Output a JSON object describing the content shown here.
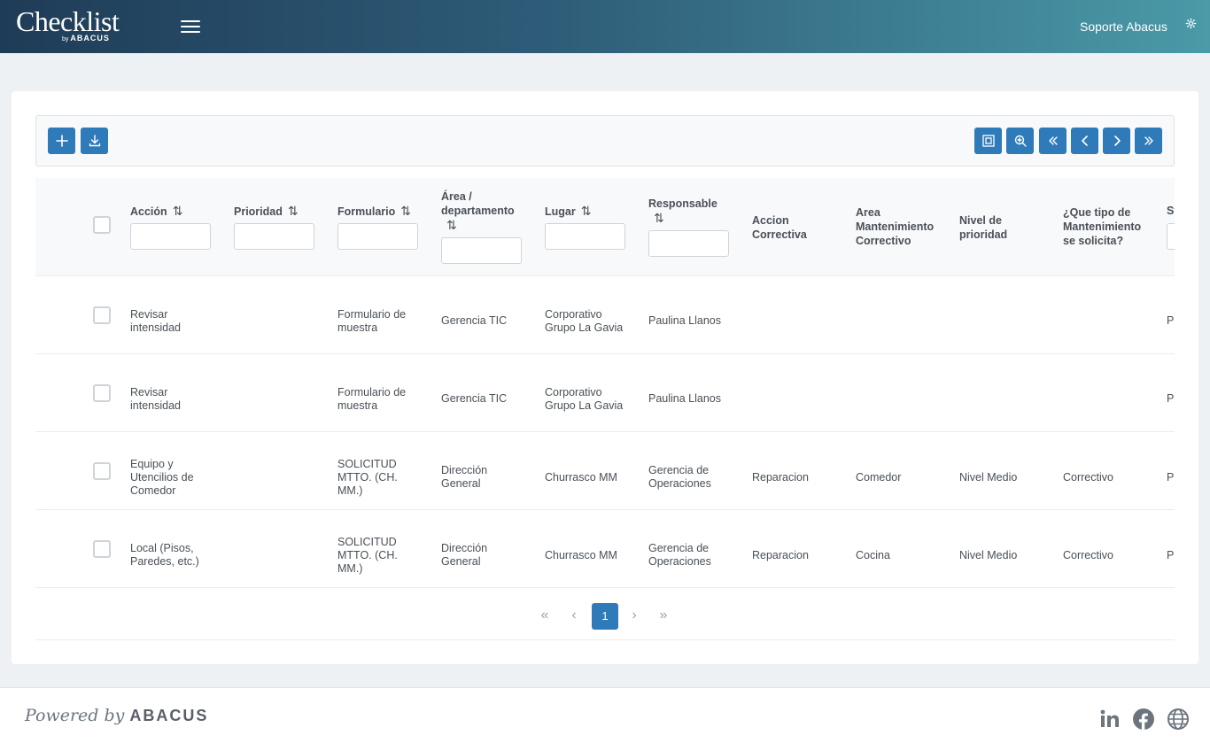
{
  "header": {
    "logo_main": "Checklist",
    "logo_by": "by",
    "logo_brand": "ABACUS",
    "user_name": "Soporte Abacus"
  },
  "pager": {
    "first": "«",
    "prev": "‹",
    "current": "1",
    "next": "›",
    "last": "»"
  },
  "table": {
    "sort_glyph": "⇅",
    "columns": [
      {
        "label": "Acción"
      },
      {
        "label": "Prioridad"
      },
      {
        "label": "Formulario"
      },
      {
        "label": "Área / departamento"
      },
      {
        "label": "Lugar"
      },
      {
        "label": "Responsable"
      },
      {
        "label": "Accion Correctiva"
      },
      {
        "label": "Area Mantenimiento Correctivo"
      },
      {
        "label": "Nivel de prioridad"
      },
      {
        "label": "¿Que tipo de Mantenimiento se solicita?"
      },
      {
        "label": "St"
      }
    ],
    "rows": [
      {
        "accion": "Revisar intensidad",
        "prioridad": "",
        "formulario": "Formulario de muestra",
        "area": "Gerencia TIC",
        "lugar": "Corporativo Grupo La Gavia",
        "responsable": "Paulina Llanos",
        "accion_correctiva": "",
        "area_mant": "",
        "nivel": "",
        "tipo": "",
        "status": "Pe"
      },
      {
        "accion": "Revisar intensidad",
        "prioridad": "",
        "formulario": "Formulario de muestra",
        "area": "Gerencia TIC",
        "lugar": "Corporativo Grupo La Gavia",
        "responsable": "Paulina Llanos",
        "accion_correctiva": "",
        "area_mant": "",
        "nivel": "",
        "tipo": "",
        "status": "Pe"
      },
      {
        "accion": "Equipo y Utencilios de Comedor",
        "prioridad": "",
        "formulario": "SOLICITUD MTTO. (CH. MM.)",
        "area": "Dirección General",
        "lugar": "Churrasco MM",
        "responsable": "Gerencia de Operaciones",
        "accion_correctiva": "Reparacion",
        "area_mant": "Comedor",
        "nivel": "Nivel Medio",
        "tipo": "Correctivo",
        "status": "Pe"
      },
      {
        "accion": "Local (Pisos, Paredes, etc.)",
        "prioridad": "",
        "formulario": "SOLICITUD MTTO. (CH. MM.)",
        "area": "Dirección General",
        "lugar": "Churrasco MM",
        "responsable": "Gerencia de Operaciones",
        "accion_correctiva": "Reparacion",
        "area_mant": "Cocina",
        "nivel": "Nivel Medio",
        "tipo": "Correctivo",
        "status": "Pe"
      }
    ]
  },
  "footer": {
    "powered_by": "Powered by",
    "brand": "ABACUS"
  },
  "colors": {
    "primary": "#2f7ab8",
    "header_start": "#1f3c57",
    "header_end": "#4a9aa8"
  }
}
